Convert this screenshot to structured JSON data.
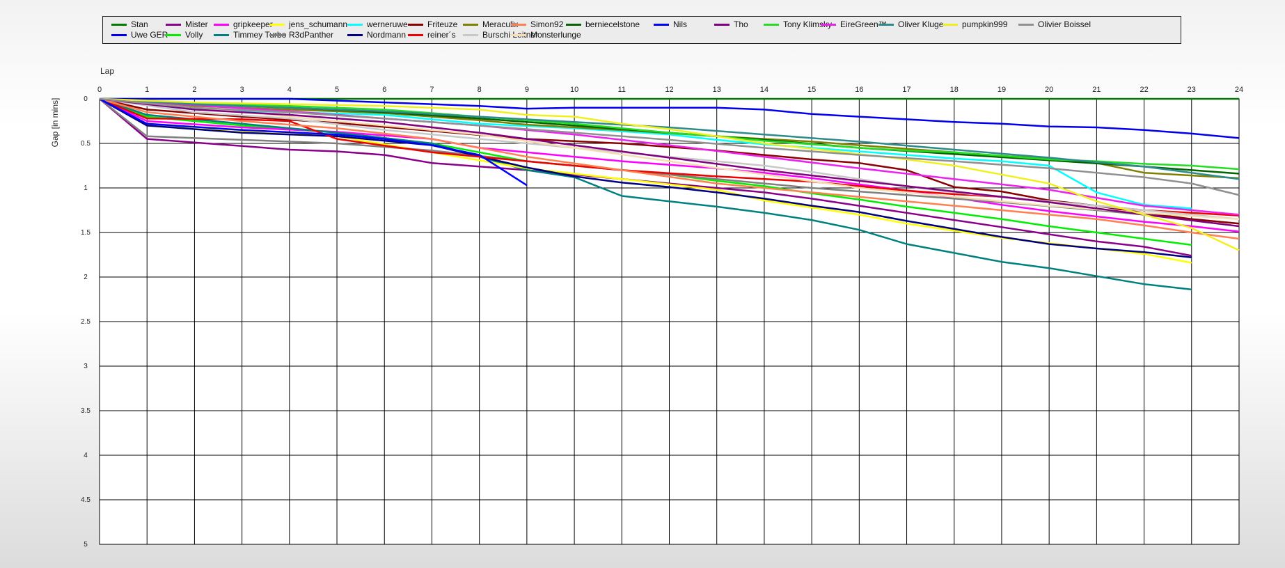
{
  "chart_data": {
    "type": "line",
    "x_axis_label": "Lap",
    "y_axis_label": "Gap [in mins]",
    "x_ticks": [
      0,
      1,
      2,
      3,
      4,
      5,
      6,
      7,
      8,
      9,
      10,
      11,
      12,
      13,
      14,
      15,
      16,
      17,
      18,
      19,
      20,
      21,
      22,
      23,
      24
    ],
    "y_ticks": [
      0,
      0.5,
      1,
      1.5,
      2,
      2.5,
      3,
      3.5,
      4,
      4.5,
      5
    ],
    "y_tick_labels": [
      "0",
      "0.5",
      "1",
      "1.5",
      "2",
      "2.5",
      "3",
      "3.5",
      "4",
      "4.5",
      "5"
    ],
    "xlim": [
      0,
      24
    ],
    "ylim": [
      0,
      5
    ],
    "y_inverted": true,
    "grid": true,
    "legend_position": "top",
    "series": [
      {
        "name": "Stan",
        "color": "#007a00",
        "x": [
          0,
          24
        ],
        "y": [
          0,
          0
        ]
      },
      {
        "name": "Uwe GER",
        "color": "#0000ee",
        "x": [
          0,
          2,
          4,
          6,
          8,
          9,
          10,
          12,
          13,
          14,
          15,
          16,
          17,
          18,
          19,
          20,
          21,
          22,
          23,
          24
        ],
        "y": [
          0,
          0,
          0,
          0.04,
          0.08,
          0.11,
          0.1,
          0.1,
          0.1,
          0.12,
          0.17,
          0.2,
          0.23,
          0.26,
          0.28,
          0.31,
          0.32,
          0.35,
          0.39,
          0.44
        ]
      },
      {
        "name": "Mister",
        "color": "#8b008b",
        "x": [
          0,
          1,
          2,
          3,
          4,
          5,
          6,
          7,
          8,
          9,
          10,
          11,
          12,
          13,
          14,
          15,
          16,
          17,
          18,
          19,
          20,
          21,
          22,
          23
        ],
        "y": [
          0,
          0.45,
          0.49,
          0.53,
          0.57,
          0.59,
          0.63,
          0.72,
          0.76,
          0.8,
          0.85,
          0.9,
          0.95,
          1.0,
          1.05,
          1.12,
          1.2,
          1.28,
          1.36,
          1.44,
          1.52,
          1.6,
          1.66,
          1.76
        ]
      },
      {
        "name": "Volly",
        "color": "#00ee00",
        "x": [
          0,
          1,
          3,
          5,
          7,
          9,
          10,
          11,
          12,
          13,
          14,
          15,
          16,
          17,
          18,
          19,
          20,
          21,
          22,
          23
        ],
        "y": [
          0,
          0.2,
          0.3,
          0.38,
          0.5,
          0.7,
          0.75,
          0.8,
          0.85,
          0.92,
          0.98,
          1.06,
          1.13,
          1.21,
          1.28,
          1.35,
          1.43,
          1.5,
          1.57,
          1.64
        ]
      },
      {
        "name": "gripkeeper",
        "color": "#ff00ff",
        "x": [
          0,
          1,
          3,
          5,
          7,
          8,
          9,
          10,
          11,
          12,
          13,
          14,
          15,
          16,
          17,
          18,
          19,
          20,
          21,
          22,
          23,
          24
        ],
        "y": [
          0,
          0.25,
          0.32,
          0.37,
          0.45,
          0.55,
          0.6,
          0.65,
          0.7,
          0.74,
          0.78,
          0.83,
          0.89,
          0.96,
          1.03,
          1.11,
          1.19,
          1.26,
          1.32,
          1.38,
          1.43,
          1.49
        ]
      },
      {
        "name": "Timmey Turbo",
        "color": "#008080",
        "x": [
          0,
          1,
          3,
          5,
          7,
          9,
          10,
          11,
          12,
          13,
          14,
          15,
          16,
          17,
          18,
          19,
          20,
          21,
          22,
          23
        ],
        "y": [
          0,
          0.18,
          0.28,
          0.38,
          0.5,
          0.8,
          0.88,
          1.09,
          1.15,
          1.21,
          1.28,
          1.36,
          1.47,
          1.63,
          1.73,
          1.83,
          1.9,
          1.99,
          2.08,
          2.14
        ]
      },
      {
        "name": "jens_schumann",
        "color": "#ffff00",
        "x": [
          0,
          1,
          3,
          5,
          7,
          9,
          10,
          11,
          12,
          13,
          14,
          15,
          16,
          17,
          18,
          19,
          20,
          21,
          22,
          23
        ],
        "y": [
          0,
          0.3,
          0.36,
          0.42,
          0.6,
          0.78,
          0.84,
          0.9,
          0.96,
          1.02,
          1.14,
          1.22,
          1.3,
          1.4,
          1.48,
          1.56,
          1.62,
          1.68,
          1.74,
          1.84
        ]
      },
      {
        "name": "R3dPanther",
        "color": "#808080",
        "x": [
          0,
          1,
          3,
          5,
          7,
          9,
          11,
          13,
          15,
          17,
          19,
          21,
          23,
          24
        ],
        "y": [
          0,
          0.42,
          0.46,
          0.5,
          0.58,
          0.7,
          0.8,
          0.9,
          1.0,
          1.08,
          1.16,
          1.25,
          1.35,
          1.4
        ]
      },
      {
        "name": "werneruwe",
        "color": "#00ffff",
        "x": [
          0,
          2,
          4,
          6,
          8,
          10,
          12,
          13,
          14,
          15,
          16,
          17,
          18,
          19,
          20,
          21,
          22,
          23
        ],
        "y": [
          0,
          0.12,
          0.15,
          0.18,
          0.28,
          0.33,
          0.4,
          0.46,
          0.51,
          0.55,
          0.59,
          0.63,
          0.67,
          0.7,
          0.75,
          1.05,
          1.19,
          1.23
        ]
      },
      {
        "name": "Nordmann",
        "color": "#000080",
        "x": [
          0,
          1,
          3,
          5,
          7,
          9,
          10,
          11,
          12,
          13,
          14,
          15,
          16,
          17,
          18,
          19,
          20,
          21,
          22,
          23
        ],
        "y": [
          0,
          0.3,
          0.38,
          0.42,
          0.52,
          0.77,
          0.87,
          0.94,
          0.99,
          1.05,
          1.12,
          1.2,
          1.27,
          1.37,
          1.46,
          1.55,
          1.63,
          1.68,
          1.72,
          1.78
        ]
      },
      {
        "name": "Friteuze",
        "color": "#8b0000",
        "x": [
          0,
          1,
          3,
          5,
          7,
          9,
          11,
          13,
          14,
          15,
          16,
          17,
          18,
          19,
          20,
          21,
          22,
          23,
          24
        ],
        "y": [
          0,
          0.12,
          0.2,
          0.27,
          0.36,
          0.45,
          0.5,
          0.58,
          0.63,
          0.68,
          0.72,
          0.8,
          0.99,
          1.04,
          1.14,
          1.2,
          1.28,
          1.35,
          1.4
        ]
      },
      {
        "name": "reiner´s",
        "color": "#ee0000",
        "x": [
          0,
          1,
          3,
          4,
          5,
          7,
          9,
          11,
          13,
          15,
          16,
          17,
          18,
          19,
          20,
          21,
          22,
          23,
          24
        ],
        "y": [
          0,
          0.22,
          0.23,
          0.25,
          0.45,
          0.6,
          0.7,
          0.8,
          0.87,
          0.93,
          0.98,
          1.03,
          1.07,
          1.1,
          1.15,
          1.2,
          1.25,
          1.28,
          1.31
        ]
      },
      {
        "name": "Meraculix",
        "color": "#808000",
        "x": [
          0,
          2,
          4,
          6,
          8,
          9,
          11,
          13,
          15,
          16,
          17,
          18,
          19,
          20,
          21,
          22,
          23,
          24
        ],
        "y": [
          0,
          0.08,
          0.12,
          0.16,
          0.24,
          0.29,
          0.35,
          0.42,
          0.48,
          0.52,
          0.56,
          0.6,
          0.64,
          0.67,
          0.72,
          0.83,
          0.86,
          0.89
        ]
      },
      {
        "name": "Burschi Leitner",
        "color": "#c8c8c8",
        "x": [
          0,
          2,
          4,
          6,
          8,
          10,
          11,
          12,
          13,
          14,
          15,
          16,
          17,
          18,
          19,
          20,
          21,
          22,
          23,
          24
        ],
        "y": [
          0,
          0.15,
          0.22,
          0.35,
          0.45,
          0.55,
          0.6,
          0.65,
          0.7,
          0.75,
          0.82,
          0.9,
          0.98,
          1.05,
          1.1,
          1.15,
          1.2,
          1.25,
          1.3,
          1.35
        ]
      },
      {
        "name": "Simon92",
        "color": "#ff7f50",
        "x": [
          0,
          1,
          3,
          5,
          7,
          9,
          11,
          13,
          15,
          17,
          18,
          19,
          20,
          21,
          22,
          23,
          24
        ],
        "y": [
          0,
          0.15,
          0.25,
          0.33,
          0.45,
          0.65,
          0.8,
          0.95,
          1.05,
          1.15,
          1.2,
          1.25,
          1.3,
          1.35,
          1.42,
          1.5,
          1.57
        ]
      },
      {
        "name": "Monsterlunge",
        "color": "#f5deb3",
        "x": [
          0,
          2,
          4,
          6,
          8,
          10,
          12,
          14,
          16,
          18,
          20,
          22,
          24
        ],
        "y": [
          0,
          0.1,
          0.2,
          0.3,
          0.4,
          0.55,
          0.7,
          0.85,
          1.0,
          1.1,
          1.2,
          1.28,
          1.35
        ]
      },
      {
        "name": "berniecelstone",
        "color": "#006400",
        "x": [
          0,
          2,
          4,
          6,
          8,
          10,
          12,
          14,
          16,
          18,
          20,
          22,
          23,
          24
        ],
        "y": [
          0,
          0.06,
          0.1,
          0.15,
          0.22,
          0.3,
          0.38,
          0.46,
          0.55,
          0.62,
          0.69,
          0.76,
          0.8,
          0.84
        ]
      },
      {
        "name": "Nils",
        "color": "#0000ff",
        "x": [
          0,
          1,
          3,
          5,
          6,
          7,
          8,
          9
        ],
        "y": [
          0,
          0.28,
          0.35,
          0.4,
          0.45,
          0.52,
          0.63,
          0.97
        ]
      },
      {
        "name": "Tho",
        "color": "#800080",
        "x": [
          0,
          2,
          4,
          6,
          8,
          10,
          12,
          14,
          16,
          18,
          20,
          22,
          24
        ],
        "y": [
          0,
          0.12,
          0.18,
          0.26,
          0.38,
          0.52,
          0.66,
          0.8,
          0.92,
          1.04,
          1.16,
          1.3,
          1.43
        ]
      },
      {
        "name": "Tony Klimsky",
        "color": "#22dd22",
        "x": [
          0,
          2,
          4,
          6,
          8,
          10,
          11,
          12,
          13,
          14,
          15,
          16,
          17,
          18,
          19,
          20,
          21,
          22,
          23,
          24
        ],
        "y": [
          0,
          0.05,
          0.08,
          0.12,
          0.2,
          0.28,
          0.33,
          0.38,
          0.42,
          0.47,
          0.51,
          0.55,
          0.58,
          0.6,
          0.64,
          0.68,
          0.7,
          0.73,
          0.75,
          0.79
        ]
      },
      {
        "name": "EireGreen™",
        "color": "#ee22ee",
        "x": [
          0,
          2,
          4,
          6,
          8,
          10,
          12,
          14,
          16,
          18,
          20,
          22,
          23,
          24
        ],
        "y": [
          0,
          0.07,
          0.14,
          0.22,
          0.3,
          0.4,
          0.52,
          0.65,
          0.78,
          0.9,
          1.02,
          1.2,
          1.25,
          1.3
        ]
      },
      {
        "name": "Oliver Kluge",
        "color": "#2e8b8b",
        "x": [
          0,
          2,
          4,
          6,
          8,
          10,
          12,
          14,
          16,
          18,
          20,
          22,
          24
        ],
        "y": [
          0,
          0.06,
          0.1,
          0.14,
          0.2,
          0.26,
          0.32,
          0.4,
          0.48,
          0.57,
          0.66,
          0.76,
          0.9
        ]
      },
      {
        "name": "pumpkin999",
        "color": "#f0f020",
        "x": [
          0,
          2,
          4,
          6,
          8,
          9,
          10,
          11,
          12,
          13,
          14,
          15,
          16,
          17,
          18,
          19,
          20,
          21,
          22,
          23,
          24
        ],
        "y": [
          0,
          0.04,
          0.06,
          0.08,
          0.12,
          0.18,
          0.2,
          0.28,
          0.34,
          0.42,
          0.5,
          0.56,
          0.62,
          0.68,
          0.75,
          0.85,
          0.95,
          1.15,
          1.3,
          1.45,
          1.7
        ]
      },
      {
        "name": "Olivier Boissel",
        "color": "#909090",
        "x": [
          0,
          2,
          4,
          6,
          8,
          10,
          12,
          14,
          16,
          18,
          20,
          22,
          23,
          24
        ],
        "y": [
          0,
          0.1,
          0.15,
          0.22,
          0.3,
          0.38,
          0.46,
          0.55,
          0.63,
          0.7,
          0.78,
          0.88,
          0.95,
          1.08
        ]
      }
    ]
  }
}
